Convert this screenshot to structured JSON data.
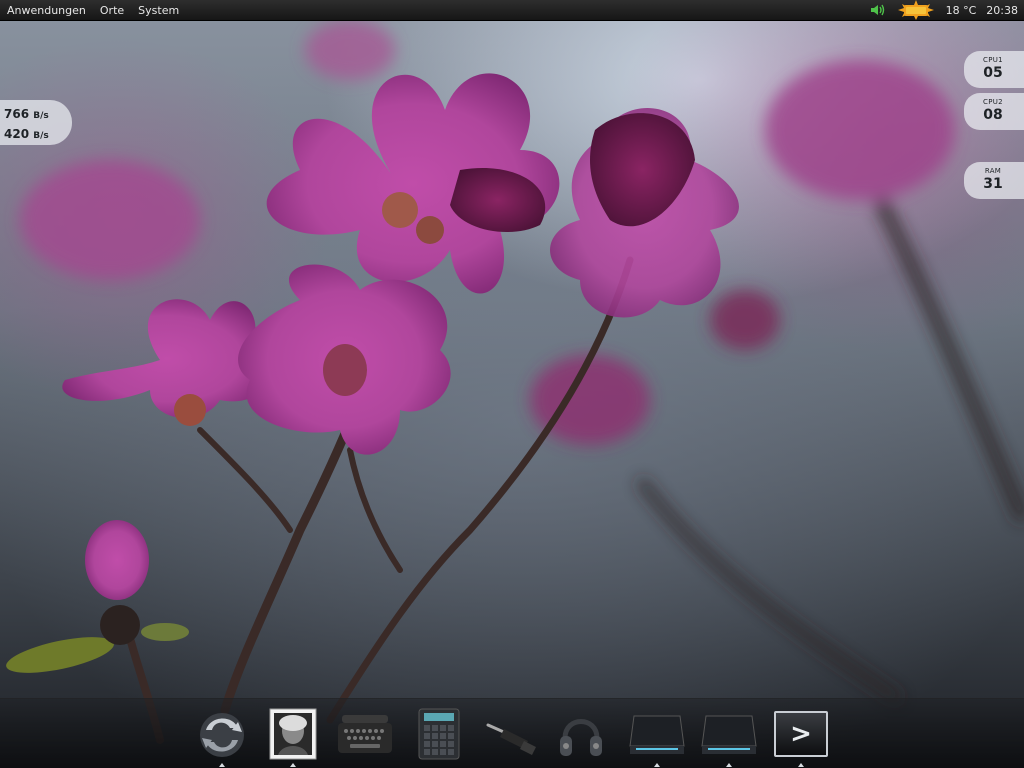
{
  "top_panel": {
    "menus": [
      "Anwendungen",
      "Orte",
      "System"
    ],
    "weather_temp": "18 °C",
    "clock": "20:38",
    "icons": {
      "volume": "volume-icon",
      "weather": "sun-weather-icon"
    }
  },
  "net_widget": {
    "download_value": "766",
    "download_unit": "B/s",
    "upload_value": "420",
    "upload_unit": "B/s"
  },
  "sys_widgets": {
    "cpu1": {
      "label": "CPU1",
      "value": "05"
    },
    "cpu2": {
      "label": "CPU2",
      "value": "08"
    },
    "ram": {
      "label": "RAM",
      "value": "31"
    }
  },
  "dock": {
    "items": [
      {
        "name": "update-icon",
        "running": true
      },
      {
        "name": "portrait-icon",
        "running": true
      },
      {
        "name": "typewriter-icon",
        "running": false
      },
      {
        "name": "calculator-icon",
        "running": false
      },
      {
        "name": "screwdriver-icon",
        "running": false
      },
      {
        "name": "headphones-icon",
        "running": false
      },
      {
        "name": "drive-icon",
        "running": true
      },
      {
        "name": "drive-icon",
        "running": true
      },
      {
        "name": "terminal-icon",
        "running": true
      }
    ],
    "terminal_prompt": ">"
  },
  "colors": {
    "panel": "#1e1e1e",
    "accent_flower": "#b0469c",
    "widget_bg": "#eceff2"
  }
}
